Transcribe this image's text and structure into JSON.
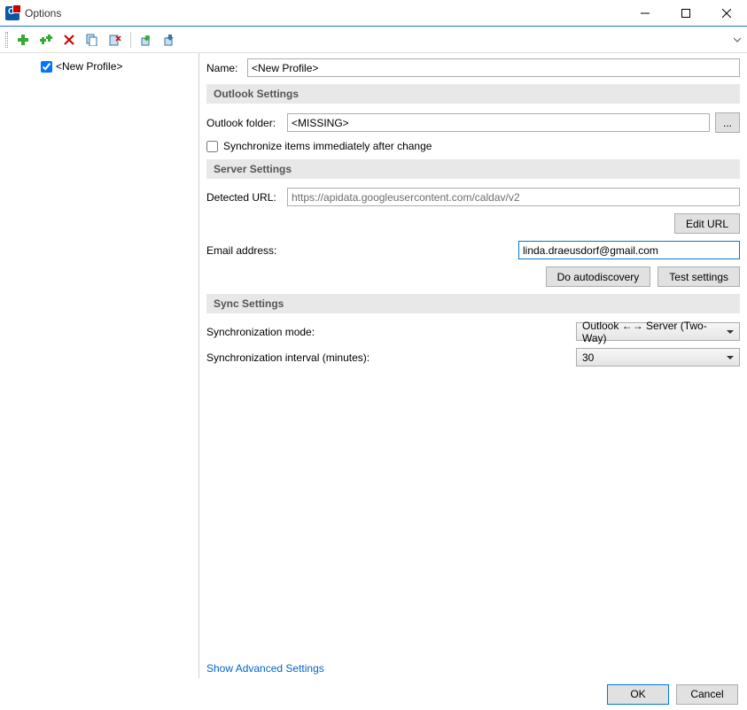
{
  "window": {
    "title": "Options"
  },
  "sidebar": {
    "items": [
      {
        "label": "<New Profile>",
        "checked": true
      }
    ]
  },
  "form": {
    "name_label": "Name:",
    "name_value": "<New Profile>"
  },
  "outlook": {
    "section": "Outlook Settings",
    "folder_label": "Outlook folder:",
    "folder_value": "<MISSING>",
    "browse_label": "...",
    "sync_checkbox_label": "Synchronize items immediately after change",
    "sync_checked": false
  },
  "server": {
    "section": "Server Settings",
    "detected_label": "Detected URL:",
    "detected_value": "https://apidata.googleusercontent.com/caldav/v2",
    "edit_url": "Edit URL",
    "email_label": "Email address:",
    "email_value": "linda.draeusdorf@gmail.com",
    "autodiscovery": "Do autodiscovery",
    "test": "Test settings"
  },
  "sync": {
    "section": "Sync Settings",
    "mode_label": "Synchronization mode:",
    "mode_value": "Outlook ←→ Server (Two-Way)",
    "interval_label": "Synchronization interval (minutes):",
    "interval_value": "30"
  },
  "advanced_link": "Show Advanced Settings",
  "buttons": {
    "ok": "OK",
    "cancel": "Cancel"
  }
}
